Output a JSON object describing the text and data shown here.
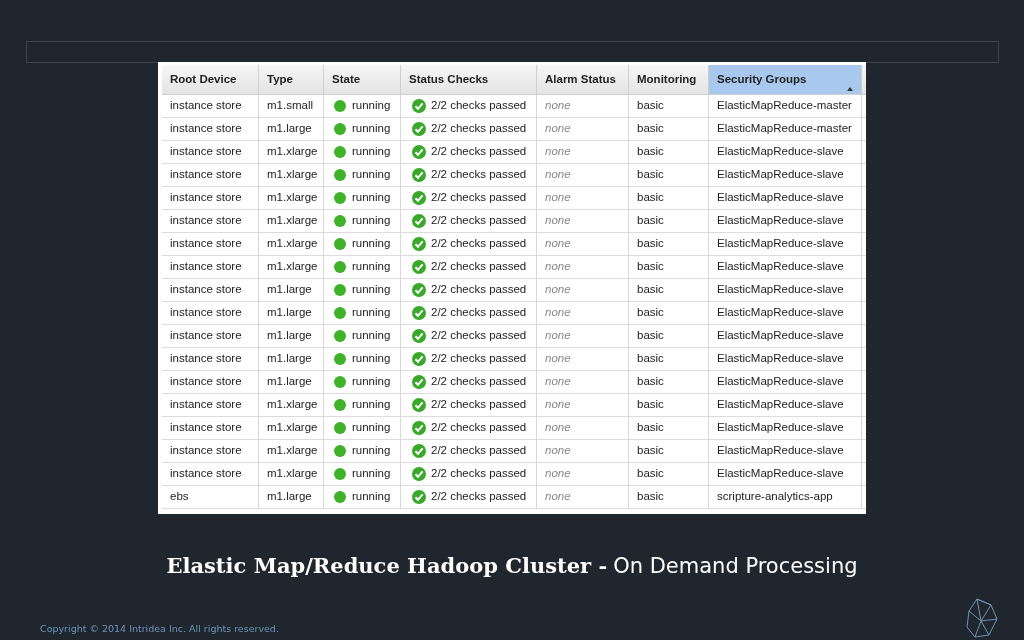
{
  "table": {
    "columns": [
      {
        "label": "Root Device",
        "selected": false
      },
      {
        "label": "Type",
        "selected": false
      },
      {
        "label": "State",
        "selected": false
      },
      {
        "label": "Status Checks",
        "selected": false
      },
      {
        "label": "Alarm Status",
        "selected": false
      },
      {
        "label": "Monitoring",
        "selected": false
      },
      {
        "label": "Security Groups",
        "selected": true
      }
    ],
    "rows": [
      {
        "root_device": "instance store",
        "type": "m1.small",
        "state": "running",
        "status_checks": "2/2 checks passed",
        "alarm_status": "none",
        "monitoring": "basic",
        "security_groups": "ElasticMapReduce-master"
      },
      {
        "root_device": "instance store",
        "type": "m1.large",
        "state": "running",
        "status_checks": "2/2 checks passed",
        "alarm_status": "none",
        "monitoring": "basic",
        "security_groups": "ElasticMapReduce-master"
      },
      {
        "root_device": "instance store",
        "type": "m1.xlarge",
        "state": "running",
        "status_checks": "2/2 checks passed",
        "alarm_status": "none",
        "monitoring": "basic",
        "security_groups": "ElasticMapReduce-slave"
      },
      {
        "root_device": "instance store",
        "type": "m1.xlarge",
        "state": "running",
        "status_checks": "2/2 checks passed",
        "alarm_status": "none",
        "monitoring": "basic",
        "security_groups": "ElasticMapReduce-slave"
      },
      {
        "root_device": "instance store",
        "type": "m1.xlarge",
        "state": "running",
        "status_checks": "2/2 checks passed",
        "alarm_status": "none",
        "monitoring": "basic",
        "security_groups": "ElasticMapReduce-slave"
      },
      {
        "root_device": "instance store",
        "type": "m1.xlarge",
        "state": "running",
        "status_checks": "2/2 checks passed",
        "alarm_status": "none",
        "monitoring": "basic",
        "security_groups": "ElasticMapReduce-slave"
      },
      {
        "root_device": "instance store",
        "type": "m1.xlarge",
        "state": "running",
        "status_checks": "2/2 checks passed",
        "alarm_status": "none",
        "monitoring": "basic",
        "security_groups": "ElasticMapReduce-slave"
      },
      {
        "root_device": "instance store",
        "type": "m1.xlarge",
        "state": "running",
        "status_checks": "2/2 checks passed",
        "alarm_status": "none",
        "monitoring": "basic",
        "security_groups": "ElasticMapReduce-slave"
      },
      {
        "root_device": "instance store",
        "type": "m1.large",
        "state": "running",
        "status_checks": "2/2 checks passed",
        "alarm_status": "none",
        "monitoring": "basic",
        "security_groups": "ElasticMapReduce-slave"
      },
      {
        "root_device": "instance store",
        "type": "m1.large",
        "state": "running",
        "status_checks": "2/2 checks passed",
        "alarm_status": "none",
        "monitoring": "basic",
        "security_groups": "ElasticMapReduce-slave"
      },
      {
        "root_device": "instance store",
        "type": "m1.large",
        "state": "running",
        "status_checks": "2/2 checks passed",
        "alarm_status": "none",
        "monitoring": "basic",
        "security_groups": "ElasticMapReduce-slave"
      },
      {
        "root_device": "instance store",
        "type": "m1.large",
        "state": "running",
        "status_checks": "2/2 checks passed",
        "alarm_status": "none",
        "monitoring": "basic",
        "security_groups": "ElasticMapReduce-slave"
      },
      {
        "root_device": "instance store",
        "type": "m1.large",
        "state": "running",
        "status_checks": "2/2 checks passed",
        "alarm_status": "none",
        "monitoring": "basic",
        "security_groups": "ElasticMapReduce-slave"
      },
      {
        "root_device": "instance store",
        "type": "m1.xlarge",
        "state": "running",
        "status_checks": "2/2 checks passed",
        "alarm_status": "none",
        "monitoring": "basic",
        "security_groups": "ElasticMapReduce-slave"
      },
      {
        "root_device": "instance store",
        "type": "m1.xlarge",
        "state": "running",
        "status_checks": "2/2 checks passed",
        "alarm_status": "none",
        "monitoring": "basic",
        "security_groups": "ElasticMapReduce-slave"
      },
      {
        "root_device": "instance store",
        "type": "m1.xlarge",
        "state": "running",
        "status_checks": "2/2 checks passed",
        "alarm_status": "none",
        "monitoring": "basic",
        "security_groups": "ElasticMapReduce-slave"
      },
      {
        "root_device": "instance store",
        "type": "m1.xlarge",
        "state": "running",
        "status_checks": "2/2 checks passed",
        "alarm_status": "none",
        "monitoring": "basic",
        "security_groups": "ElasticMapReduce-slave"
      },
      {
        "root_device": "ebs",
        "type": "m1.large",
        "state": "running",
        "status_checks": "2/2 checks passed",
        "alarm_status": "none",
        "monitoring": "basic",
        "security_groups": "scripture-analytics-app"
      }
    ]
  },
  "caption": {
    "title": "Elastic Map/Reduce Hadoop Cluster -",
    "subtitle": "On Demand Processing"
  },
  "footer": {
    "copyright": "Copyright © 2014 Intridea Inc. All rights reserved."
  }
}
